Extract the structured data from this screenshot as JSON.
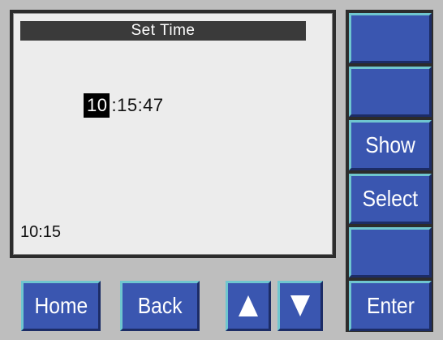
{
  "screen": {
    "title": "Set Time",
    "time_hours": "10",
    "time_rest": ":15:47",
    "status_time": "10:15"
  },
  "side_buttons": {
    "button1_label": "",
    "button2_label": "",
    "show_label": "Show",
    "select_label": "Select",
    "button5_label": "",
    "enter_label": "Enter"
  },
  "bottom_buttons": {
    "home_label": "Home",
    "back_label": "Back",
    "up_icon": "arrow-up-icon",
    "down_icon": "arrow-down-icon"
  },
  "colors": {
    "button": "#3a56b0",
    "button_highlight": "#6fc6cf",
    "screen_bg": "#ececec",
    "panel_bg": "#bebebe"
  }
}
